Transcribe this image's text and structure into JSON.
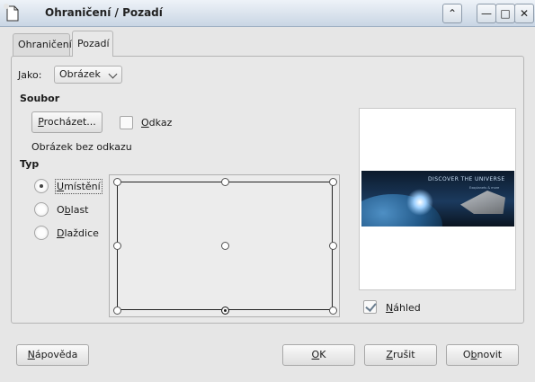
{
  "window": {
    "title": "Ohraničení / Pozadí",
    "buttons": {
      "up": "⌃",
      "minimize": "—",
      "maximize": "□",
      "close": "✕"
    }
  },
  "tabs": [
    {
      "label": "Ohraničení",
      "active": false
    },
    {
      "label": "Pozadí",
      "active": true
    }
  ],
  "as": {
    "label_accel": "J",
    "label_rest": "ako:",
    "selected": "Obrázek"
  },
  "file": {
    "heading": "Soubor",
    "browse_accel": "P",
    "browse_rest": "rocházet...",
    "link_accel": "O",
    "link_rest": "dkaz",
    "link_checked": false,
    "status": "Obrázek bez odkazu"
  },
  "type": {
    "heading": "Typ",
    "options": [
      {
        "pre": "",
        "accel": "U",
        "rest": "místění",
        "checked": true
      },
      {
        "pre": "O",
        "accel": "b",
        "rest": "last",
        "checked": false
      },
      {
        "pre": "",
        "accel": "D",
        "rest": "laždice",
        "checked": false
      }
    ]
  },
  "preview": {
    "check_accel": "N",
    "check_rest": "áhled",
    "checked": true,
    "banner_title": "DISCOVER THE UNIVERSE",
    "banner_sub": "Exoplanets & more"
  },
  "footer": {
    "help_accel": "N",
    "help_rest": "ápověda",
    "ok_accel": "O",
    "ok_rest": "K",
    "cancel_accel": "Z",
    "cancel_rest": "rušit",
    "reset_pre": "O",
    "reset_accel": "b",
    "reset_rest": "novit"
  }
}
